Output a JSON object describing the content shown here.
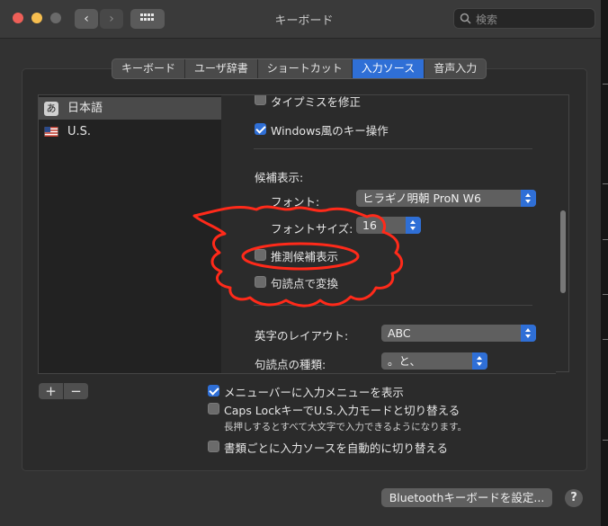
{
  "window": {
    "title": "キーボード"
  },
  "search": {
    "placeholder": "検索"
  },
  "tabs": [
    {
      "label": "キーボード",
      "active": false
    },
    {
      "label": "ユーザ辞書",
      "active": false
    },
    {
      "label": "ショートカット",
      "active": false
    },
    {
      "label": "入力ソース",
      "active": true
    },
    {
      "label": "音声入力",
      "active": false
    }
  ],
  "sources": [
    {
      "label": "日本語",
      "icon": "あ",
      "selected": true
    },
    {
      "label": "U.S.",
      "icon": "us-flag-icon",
      "selected": false
    }
  ],
  "settings": {
    "typo_fix": {
      "label": "タイプミスを修正",
      "checked": false
    },
    "windows_keys": {
      "label": "Windows風のキー操作",
      "checked": true
    },
    "candidates_heading": "候補表示:",
    "font_label": "フォント:",
    "font_value": "ヒラギノ明朝 ProN W6",
    "font_size_label": "フォントサイズ:",
    "font_size_value": "16",
    "predictive": {
      "label": "推測候補表示",
      "checked": false
    },
    "punct_convert": {
      "label": "句読点で変換",
      "checked": false
    },
    "layout_label": "英字のレイアウト:",
    "layout_value": "ABC",
    "punct_type_label": "句読点の種類:",
    "punct_type_value": "。と、"
  },
  "bottom": {
    "plus": "+",
    "minus": "−",
    "show_menu": {
      "label": "メニューバーに入力メニューを表示",
      "checked": true
    },
    "caps_lock": {
      "label": "Caps LockキーでU.S.入力モードと切り替える",
      "checked": false
    },
    "caps_lock_note": "長押しするとすべて大文字で入力できるようになります。",
    "auto_switch": {
      "label": "書類ごとに入力ソースを自動的に切り替える",
      "checked": false
    },
    "bluetooth_button": "Bluetoothキーボードを設定...",
    "help": "?"
  },
  "colors": {
    "accent": "#2f6fd6",
    "annotation": "#ff2a1a"
  }
}
